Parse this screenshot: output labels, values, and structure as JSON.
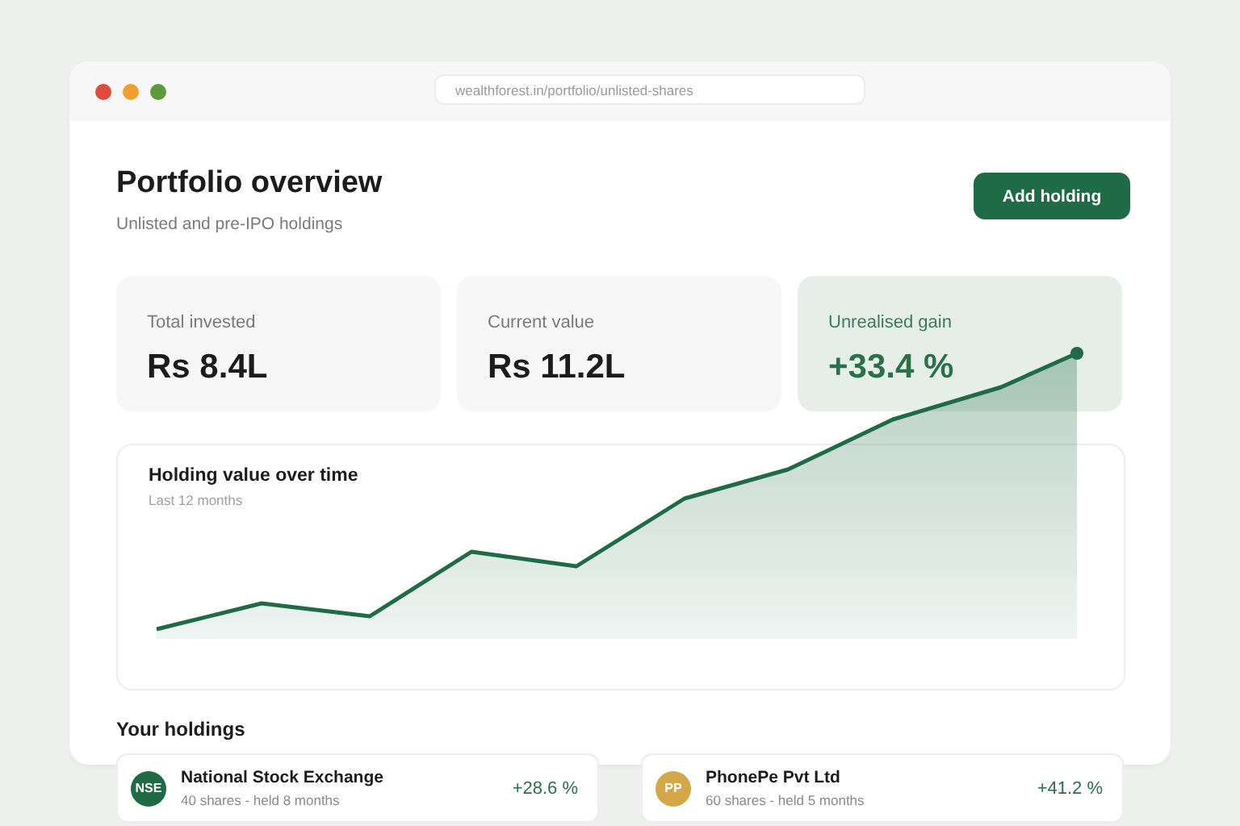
{
  "browser": {
    "url": "wealthforest.in/portfolio/unlisted-shares"
  },
  "header": {
    "title": "Portfolio overview",
    "subtitle": "Unlisted and pre-IPO holdings",
    "button": "Add holding"
  },
  "stats": [
    {
      "label": "Total invested",
      "value": "Rs 8.4L",
      "kind": "neutral"
    },
    {
      "label": "Current value",
      "value": "Rs 11.2L",
      "kind": "neutral"
    },
    {
      "label": "Unrealised gain",
      "value": "+33.4 %",
      "kind": "positive"
    }
  ],
  "chart": {
    "title": "Holding value over time",
    "subtitle": "Last 12 months"
  },
  "holdings_title": "Your holdings",
  "holdings": [
    {
      "initials": "NSE",
      "color": "#1f6b45",
      "name": "National Stock Exchange",
      "detail": "40 shares - held 8 months",
      "gain": "+28.6 %"
    },
    {
      "initials": "PP",
      "color": "#d4a849",
      "name": "PhonePe Pvt Ltd",
      "detail": "60 shares - held 5 months",
      "gain": "+41.2 %"
    }
  ]
}
